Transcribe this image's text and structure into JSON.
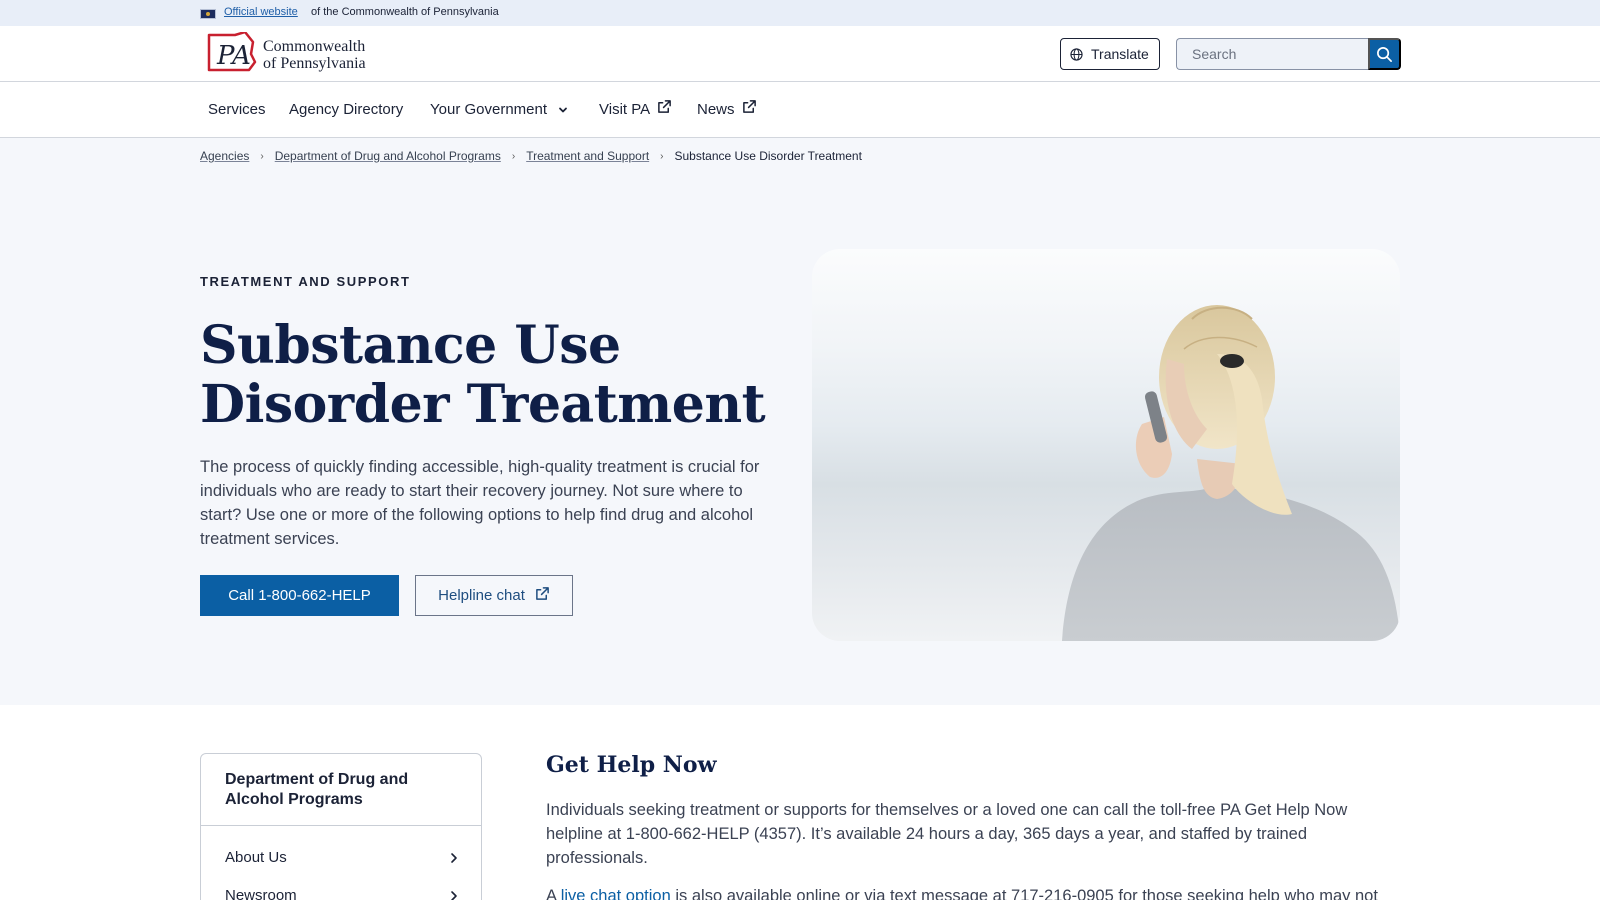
{
  "official_banner": {
    "link_text": "Official website",
    "rest_text": "of the Commonwealth of Pennsylvania"
  },
  "header": {
    "logo_mark": "PA",
    "logo_line1": "Commonwealth",
    "logo_line2": "of Pennsylvania",
    "translate_label": "Translate",
    "search_placeholder": "Search"
  },
  "nav": {
    "items": [
      {
        "label": "Services"
      },
      {
        "label": "Agency Directory"
      },
      {
        "label": "Your Government",
        "icon": "chevron-down-icon"
      },
      {
        "label": "Visit PA",
        "icon": "external-link-icon"
      },
      {
        "label": "News",
        "icon": "external-link-icon"
      }
    ]
  },
  "breadcrumb": {
    "items": [
      "Agencies",
      "Department of Drug and Alcohol Programs",
      "Treatment and Support"
    ],
    "current": "Substance Use Disorder Treatment"
  },
  "hero": {
    "eyebrow": "TREATMENT AND SUPPORT",
    "title": "Substance Use Disorder Treatment",
    "description": "The process of quickly finding accessible, high-quality treatment is crucial for individuals who are ready to start their recovery journey. Not sure where to start? Use one or more of the following options to help find drug and alcohol treatment services.",
    "primary_button": "Call 1-800-662-HELP",
    "secondary_button": "Helpline chat"
  },
  "sidenav": {
    "title": "Department of Drug and Alcohol Programs",
    "items": [
      {
        "label": "About Us"
      },
      {
        "label": "Newsroom"
      }
    ]
  },
  "content": {
    "section_title": "Get Help Now",
    "paragraph1": "Individuals seeking treatment or supports for themselves or a loved one can call the toll-free PA Get Help Now helpline at 1-800-662-HELP (4357). It’s available 24 hours a day, 365 days a year, and staffed by trained professionals.",
    "paragraph2_prefix": "A ",
    "paragraph2_link": "live chat option",
    "paragraph2_suffix": " is also available online or via text message at 717-216-0905 for those seeking help who may not"
  },
  "colors": {
    "brand_blue": "#0b5fa4",
    "navy": "#0f1f47",
    "hero_bg": "#f5f7fb",
    "logo_red": "#c8202f"
  }
}
